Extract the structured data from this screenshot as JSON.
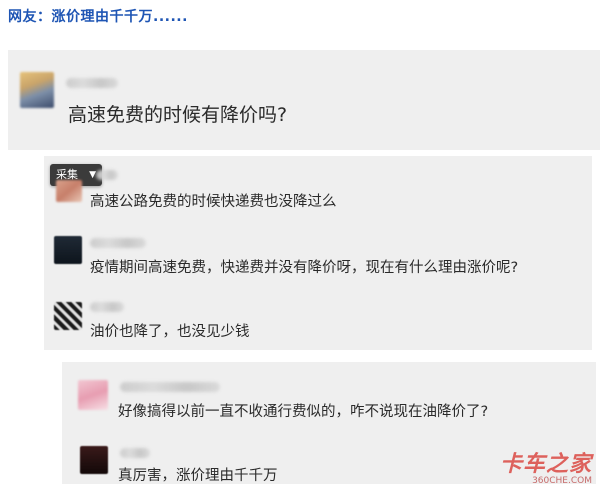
{
  "heading": "网友：涨价理由千千万......",
  "post": {
    "text": "高速免费的时候有降价吗?"
  },
  "collect_button": {
    "label": "采集",
    "icon": "caret-down-icon"
  },
  "replies_level1": [
    {
      "text": "高速公路免费的时候快递费也没降过么"
    },
    {
      "text": "疫情期间高速免费，快递费并没有降价呀，现在有什么理由涨价呢?"
    },
    {
      "text": "油价也降了，也没见少钱"
    }
  ],
  "replies_level2": [
    {
      "text": "好像搞得以前一直不收通行费似的，咋不说现在油降价了?"
    },
    {
      "text": "真厉害，涨价理由千千万"
    }
  ],
  "watermark": {
    "text": "卡车之家",
    "sub": "360CHE.COM"
  },
  "colors": {
    "heading": "#1e55b4",
    "card_bg": "#efefef",
    "watermark": "#d93a33"
  }
}
